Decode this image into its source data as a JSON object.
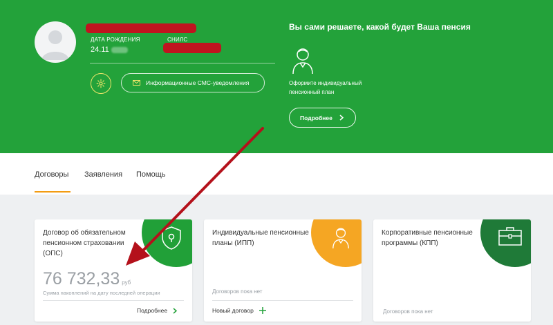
{
  "profile": {
    "birth_label": "ДАТА РОЖДЕНИЯ",
    "birth_value": "24.11",
    "snils_label": "СНИЛС"
  },
  "actions": {
    "sms_label": "Информационные СМС-уведомления"
  },
  "promo": {
    "title": "Вы сами решаете, какой будет Ваша пенсия",
    "text": "Оформите индивидуальный пенсионный план",
    "more_label": "Подробнее"
  },
  "tabs": [
    {
      "label": "Договоры",
      "active": true
    },
    {
      "label": "Заявления",
      "active": false
    },
    {
      "label": "Помощь",
      "active": false
    }
  ],
  "cards": {
    "ops": {
      "title": "Договор об обязательном пенсионном страховании (ОПС)",
      "amount": "76 732,33",
      "currency": "руб",
      "note": "Сумма накоплений на дату последней операции",
      "link": "Подробнее",
      "color": "#21a038"
    },
    "ipp": {
      "title": "Индивидуальные пенсионные планы (ИПП)",
      "empty": "Договоров пока нет",
      "link": "Новый договор",
      "color": "#f5a623"
    },
    "kpp": {
      "title": "Корпоративные пенсионные программы (КПП)",
      "empty": "Договоров пока нет",
      "color": "#1f7a38"
    }
  },
  "colors": {
    "brand_green": "#23a23a",
    "accent_orange": "#f39c12",
    "annotation_red": "#c0141f"
  }
}
